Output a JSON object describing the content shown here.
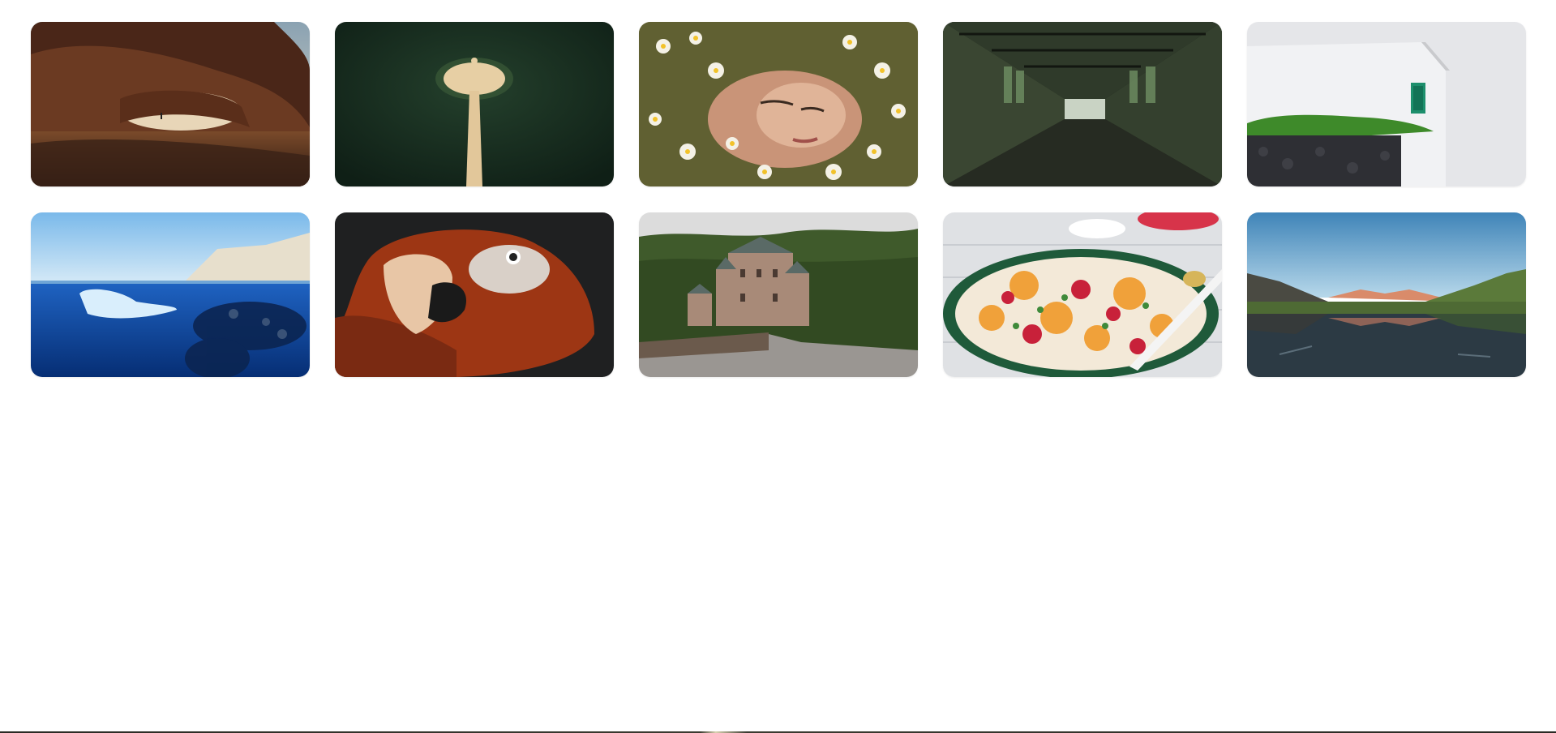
{
  "gallery": {
    "tiles": [
      {
        "subject": "desert-arch",
        "colors": {
          "sky": "#b9c3c8",
          "rock": "#6b3a22",
          "ground": "#3a2216"
        }
      },
      {
        "subject": "forest-path-aerial",
        "colors": {
          "forest": "#173022",
          "path": "#e7cfa4"
        }
      },
      {
        "subject": "woman-in-daisies",
        "colors": {
          "skin": "#d7a58a",
          "foliage": "#4f5a2c",
          "flower": "#f4f1e6"
        }
      },
      {
        "subject": "abandoned-corridor",
        "colors": {
          "wall": "#2f3a2a",
          "floor": "#1c2119",
          "light": "#c9d3c4"
        }
      },
      {
        "subject": "white-house-green-window",
        "colors": {
          "wall": "#ecedef",
          "window": "#1d8f6c",
          "plants": "#3e8a2a",
          "stone": "#2e2f34"
        }
      },
      {
        "subject": "iceberg-underwater",
        "colors": {
          "sky": "#8fc4ef",
          "water": "#0b3f97",
          "ice": "#d9eefc",
          "cliff": "#e7dfcc"
        }
      },
      {
        "subject": "macaw-parrot",
        "colors": {
          "bg": "#1f2021",
          "feathers": "#9d3614",
          "beak": "#e8c6a6"
        }
      },
      {
        "subject": "castle-in-forest",
        "colors": {
          "sky": "#dcdcdc",
          "forest": "#3f5a2b",
          "castle": "#a88a78",
          "road": "#9a9692"
        }
      },
      {
        "subject": "citrus-salad-plate",
        "colors": {
          "table": "#dfe1e4",
          "plate": "#1f5a3a",
          "orange": "#f0a13a",
          "red": "#c8213a"
        }
      },
      {
        "subject": "mountain-lake",
        "colors": {
          "sky": "#4f8fbf",
          "mountain": "#5b7a3a",
          "peak": "#d98b6a",
          "water": "#2c3a44"
        }
      }
    ]
  }
}
